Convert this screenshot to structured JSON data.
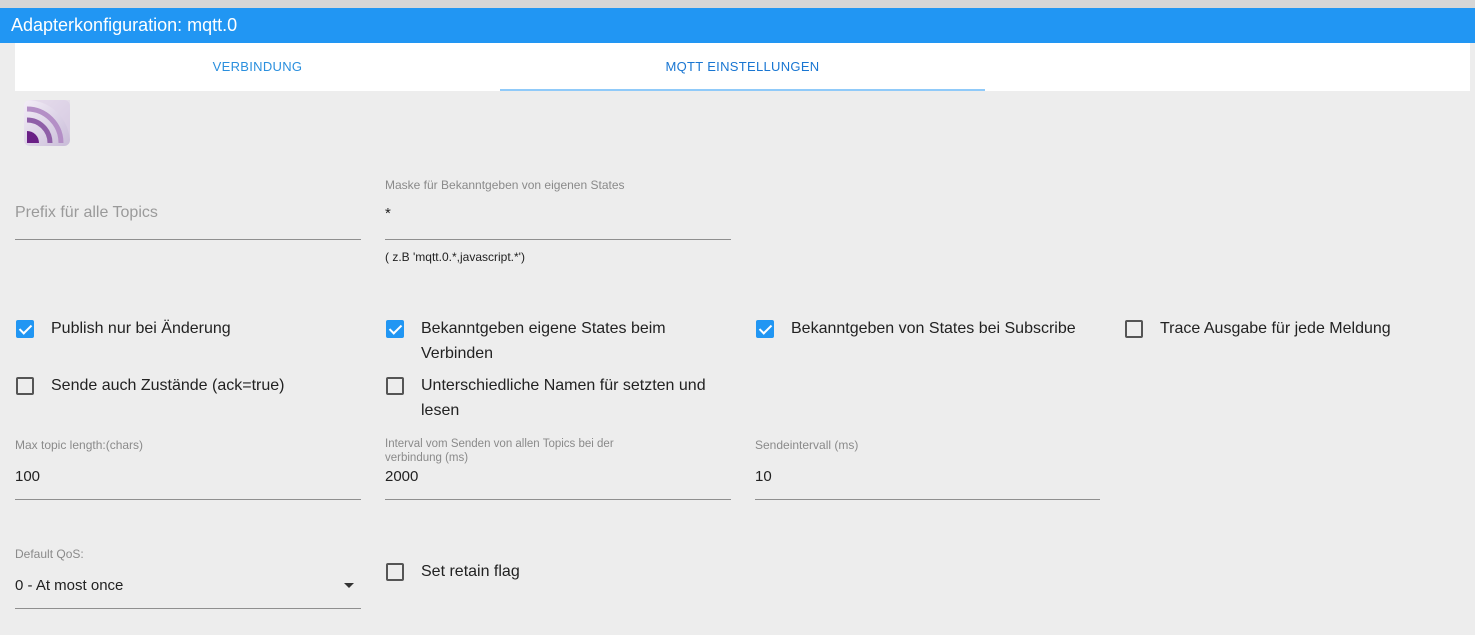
{
  "window": {
    "title": "Adapterkonfiguration: mqtt.0"
  },
  "tabs": [
    {
      "label": "VERBINDUNG",
      "active": false
    },
    {
      "label": "MQTT EINSTELLUNGEN",
      "active": true
    }
  ],
  "form": {
    "prefix": {
      "placeholder": "Prefix für alle Topics",
      "value": ""
    },
    "mask": {
      "label": "Maske für Bekanntgeben von eigenen States",
      "value": "*",
      "helper": "( z.B 'mqtt.0.*,javascript.*')"
    },
    "checkboxes": [
      {
        "label": "Publish nur bei Änderung",
        "checked": true
      },
      {
        "label": "Bekanntgeben eigene States beim Verbinden",
        "checked": true
      },
      {
        "label": "Bekanntgeben von States bei Subscribe",
        "checked": true
      },
      {
        "label": "Trace Ausgabe für jede Meldung",
        "checked": false
      },
      {
        "label": "Sende auch Zustände (ack=true)",
        "checked": false
      },
      {
        "label": "Unterschiedliche Namen für setzten und lesen",
        "checked": false
      }
    ],
    "max_topic_length": {
      "label": "Max topic length:(chars)",
      "value": "100"
    },
    "interval_all_topics": {
      "label": "Interval vom Senden von allen Topics bei der verbindung (ms)",
      "value": "2000"
    },
    "send_interval": {
      "label": "Sendeintervall (ms)",
      "value": "10"
    },
    "default_qos": {
      "label": "Default QoS:",
      "value": "0 - At most once"
    },
    "retain": {
      "label": "Set retain flag",
      "checked": false
    }
  },
  "colors": {
    "accent": "#2196f3",
    "tab_text": "#2a8fde"
  },
  "icons": {
    "logo": "mqtt-logo-icon",
    "dropdown": "dropdown-arrow-icon"
  }
}
